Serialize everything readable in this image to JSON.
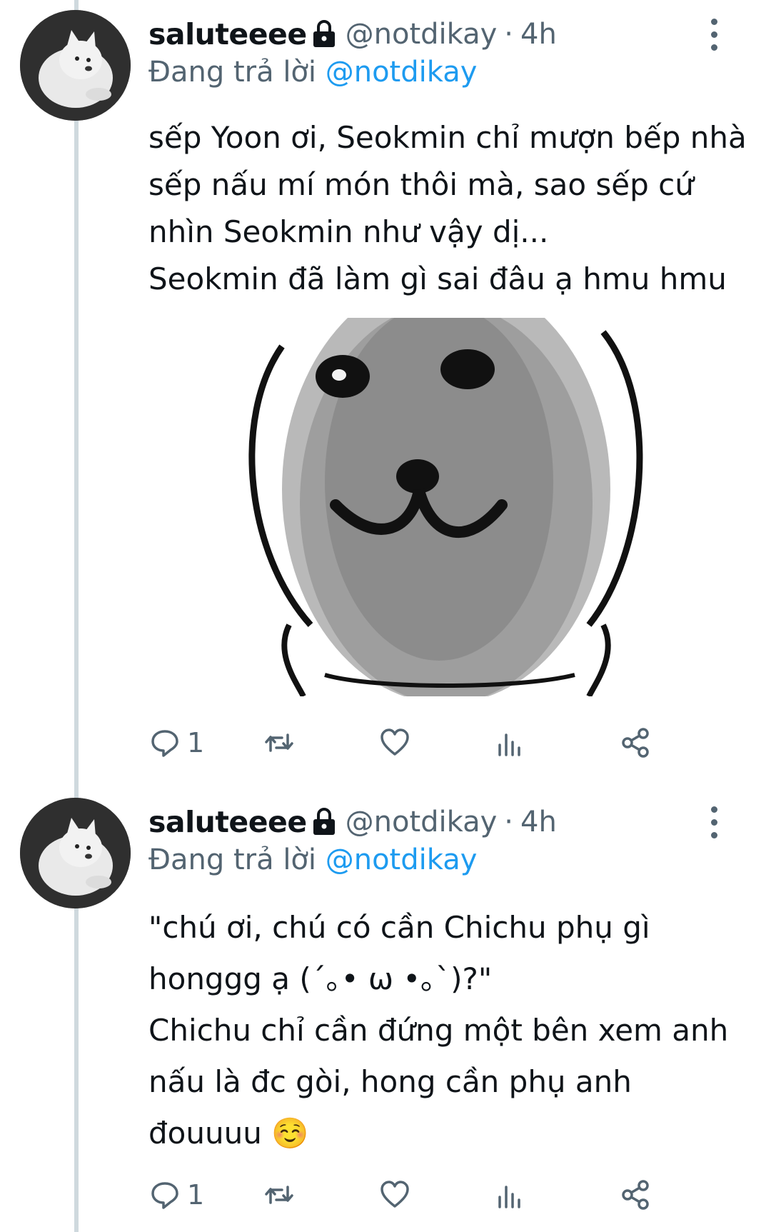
{
  "tweets": [
    {
      "display_name": "saluteeee",
      "handle": "@notdikay",
      "separator": "·",
      "time": "4h",
      "reply_prefix": "Đang trả lời ",
      "reply_to": "@notdikay",
      "lines": [
        "sếp Yoon ơi, Seokmin chỉ mượn bếp nhà",
        "sếp nấu mí món thôi mà, sao sếp cứ",
        "nhìn Seokmin như vậy dị...",
        "Seokmin đã làm gì sai đâu ạ hmu hmu"
      ],
      "reply_count": "1"
    },
    {
      "display_name": "saluteeee",
      "handle": "@notdikay",
      "separator": "·",
      "time": "4h",
      "reply_prefix": "Đang trả lời ",
      "reply_to": "@notdikay",
      "lines": [
        "\"chú ơi, chú có cần Chichu phụ gì",
        "honggg ạ (´｡• ω •｡`)?\"",
        "Chichu chỉ cần đứng một bên xem anh",
        "nấu là đc gòi, hong cần phụ anh",
        "đouuuu ☺️"
      ],
      "reply_count": "1"
    }
  ],
  "icons": {
    "lock": "lock-icon",
    "more": "more-vertical-icon",
    "reply": "reply-icon",
    "retweet": "retweet-icon",
    "like": "heart-icon",
    "analytics": "analytics-icon",
    "share": "share-icon"
  },
  "colors": {
    "text": "#0f1419",
    "secondary": "#536471",
    "mention": "#1d9bf0",
    "thread_line": "#cfd9de"
  }
}
